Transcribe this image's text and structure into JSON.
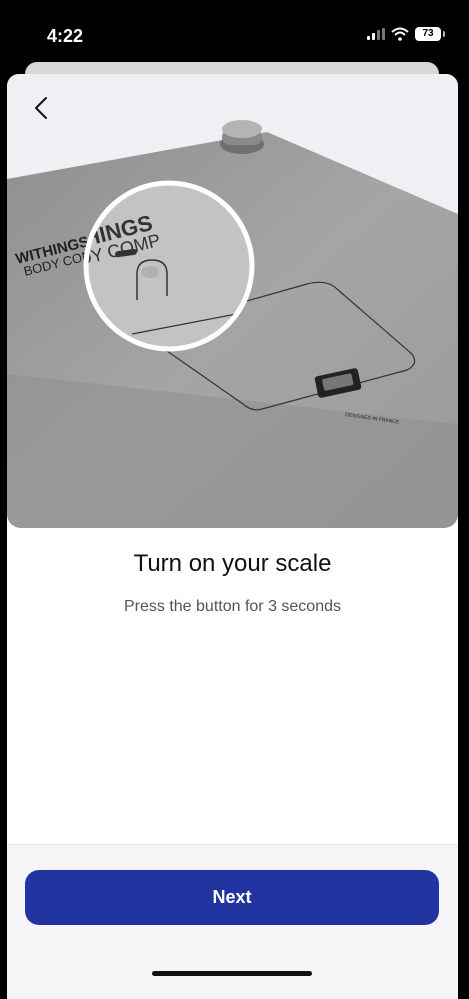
{
  "status": {
    "time": "4:22",
    "battery": "73"
  },
  "hero": {
    "brand_line1": "WITHINGS",
    "brand_line2": "BODY COMP",
    "made_in": "DESIGNED IN FRANCE"
  },
  "content": {
    "title": "Turn on your scale",
    "subtitle": "Press the button for 3 seconds"
  },
  "footer": {
    "next_label": "Next"
  },
  "colors": {
    "primary": "#2234a0"
  },
  "icons": {
    "back": "chevron-left-icon",
    "signal": "cellular-signal-icon",
    "wifi": "wifi-icon",
    "battery": "battery-icon"
  }
}
